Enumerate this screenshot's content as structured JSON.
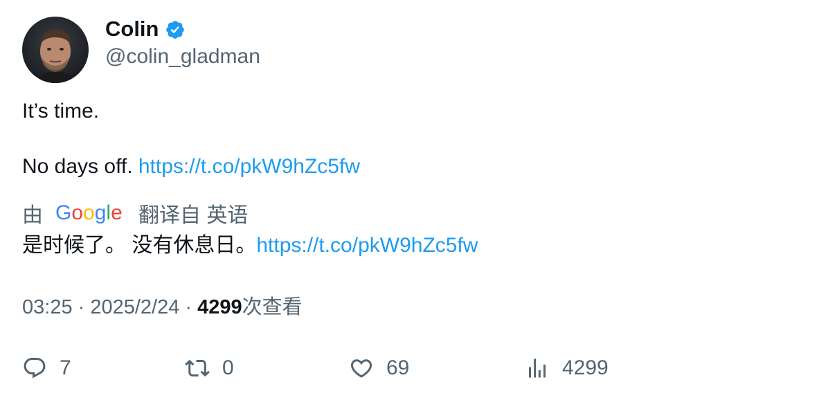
{
  "author": {
    "display_name": "Colin",
    "handle": "@colin_gladman",
    "verified": true
  },
  "tweet": {
    "line1": "It’s time.",
    "line2_text": "No days off. ",
    "line2_link": "https://t.co/pkW9hZc5fw"
  },
  "translation": {
    "by_label": "由",
    "provider": "Google",
    "translated_from_label": "翻译自 英语",
    "text": "是时候了。 没有休息日。",
    "link": "https://t.co/pkW9hZc5fw"
  },
  "meta": {
    "time": "03:25",
    "separator": " · ",
    "date": "2025/2/24",
    "views_count": "4299",
    "views_label": "次查看"
  },
  "actions": {
    "replies": "7",
    "retweets": "0",
    "likes": "69",
    "views": "4299"
  },
  "colors": {
    "link": "#1d9bf0",
    "secondary_text": "#536471",
    "primary_text": "#0f1419",
    "verified": "#1d9bf0"
  }
}
